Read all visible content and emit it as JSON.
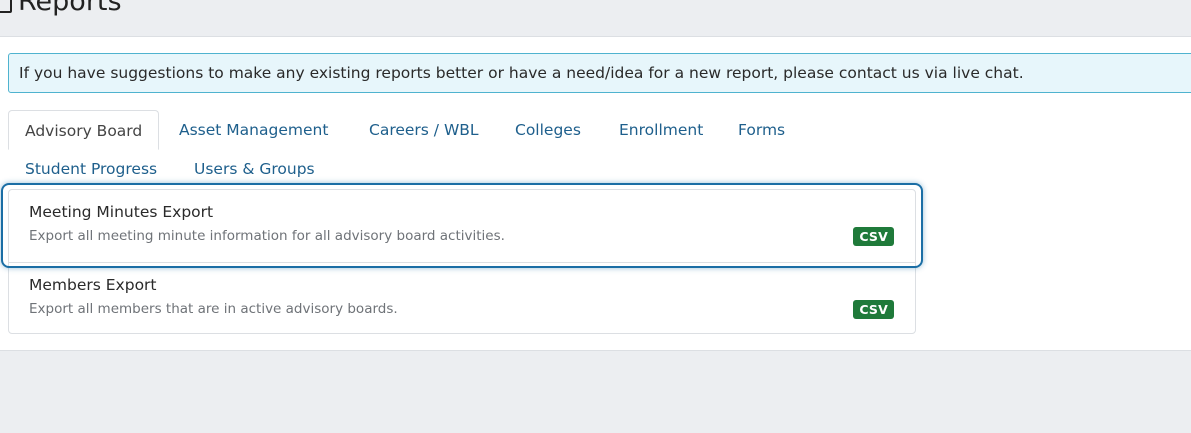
{
  "header": {
    "title": "Reports",
    "title_icon": "report-document-icon"
  },
  "alert": {
    "text": "If you have suggestions to make any existing reports better or have a need/idea for a new report, please contact us via live chat."
  },
  "tabs": [
    {
      "label": "Advisory Board",
      "active": true
    },
    {
      "label": "Asset Management",
      "active": false
    },
    {
      "label": "Careers / WBL",
      "active": false
    },
    {
      "label": "Colleges",
      "active": false
    },
    {
      "label": "Enrollment",
      "active": false
    },
    {
      "label": "Forms",
      "active": false
    },
    {
      "label": "Student Progress",
      "active": false
    },
    {
      "label": "Users & Groups",
      "active": false
    }
  ],
  "reports": [
    {
      "name": "Meeting Minutes Export",
      "description": "Export all meeting minute information for all advisory board activities.",
      "format": "CSV",
      "focused": true
    },
    {
      "name": "Members Export",
      "description": "Export all members that are in active advisory boards.",
      "format": "CSV",
      "focused": false
    }
  ],
  "colors": {
    "link": "#1e5f8c",
    "csv_badge": "#1f7a3a",
    "focus_ring": "#1b6ea5",
    "alert_bg": "#e7f6fb",
    "alert_border": "#4fb3cf"
  }
}
